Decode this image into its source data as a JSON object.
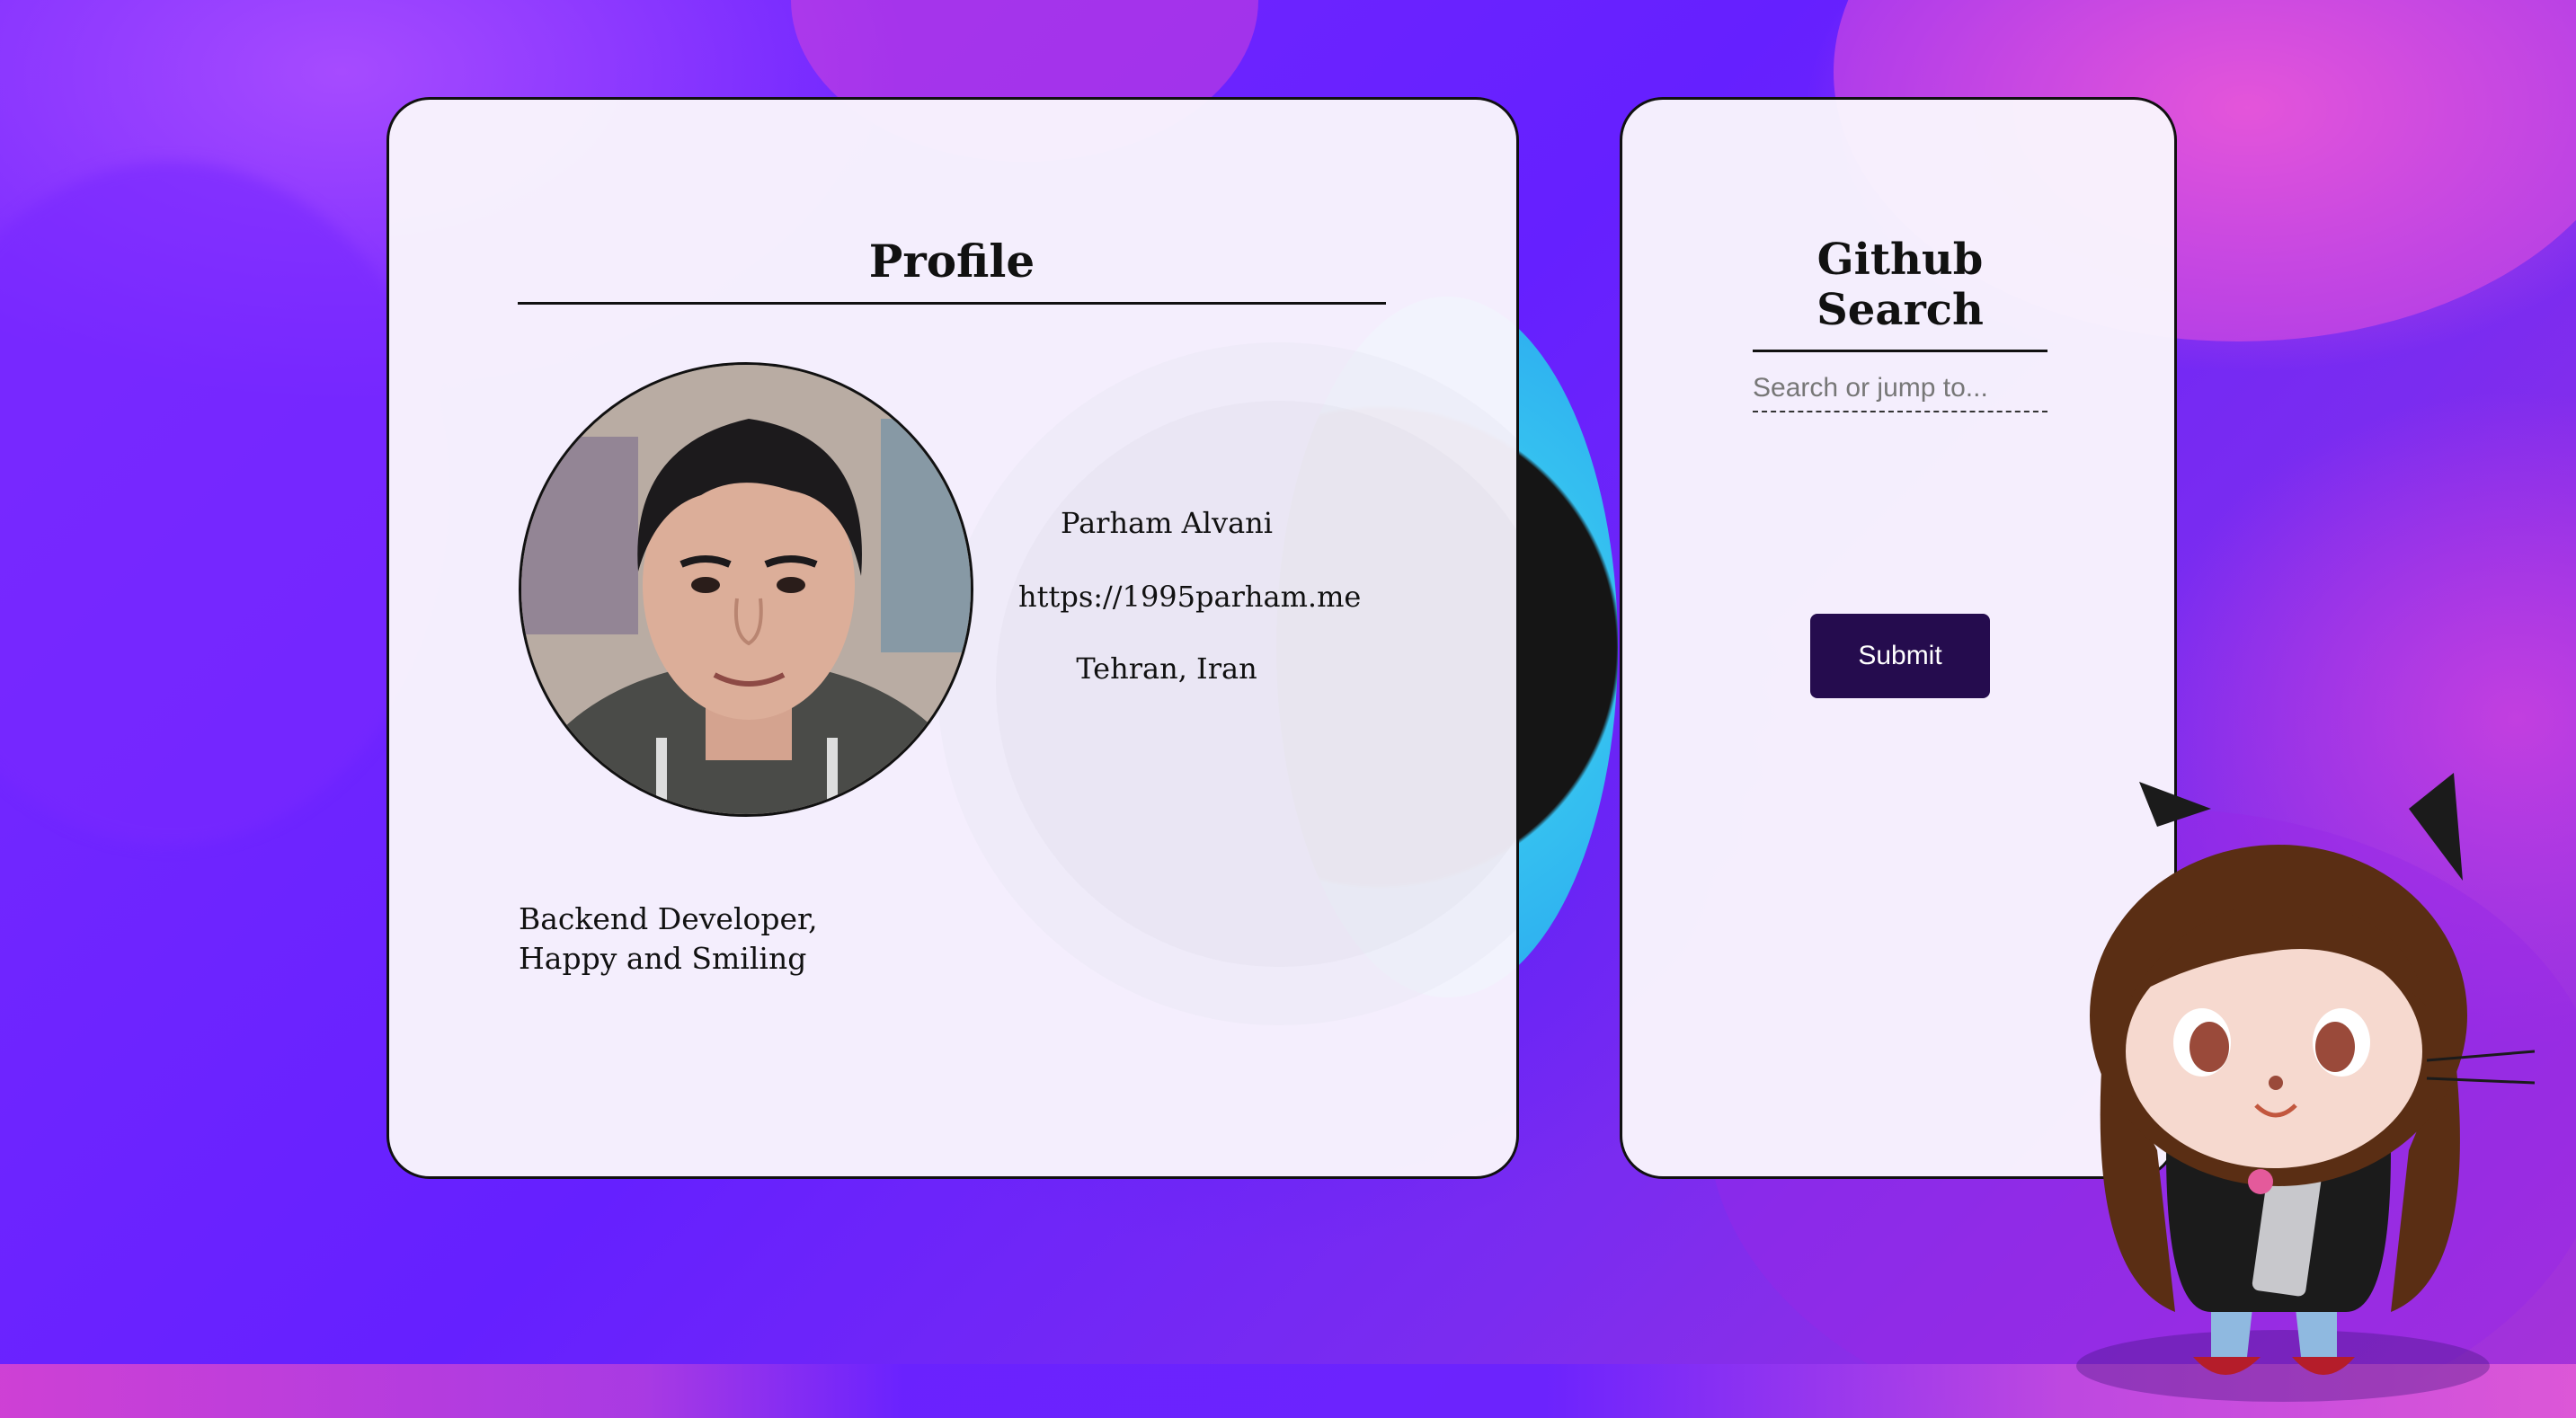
{
  "profile": {
    "title": "Profile",
    "name": "Parham Alvani",
    "website": "https://1995parham.me",
    "location": "Tehran, Iran",
    "bio_line1": "Backend Developer,",
    "bio_line2": "Happy and Smiling"
  },
  "search": {
    "title": "Github Search",
    "placeholder": "Search or jump to...",
    "value": "",
    "submit_label": "Submit"
  },
  "colors": {
    "background": "#6a22ff",
    "card": "#f9f5fd",
    "button": "#250c4e",
    "accent_ring": "#2aa7f0"
  }
}
